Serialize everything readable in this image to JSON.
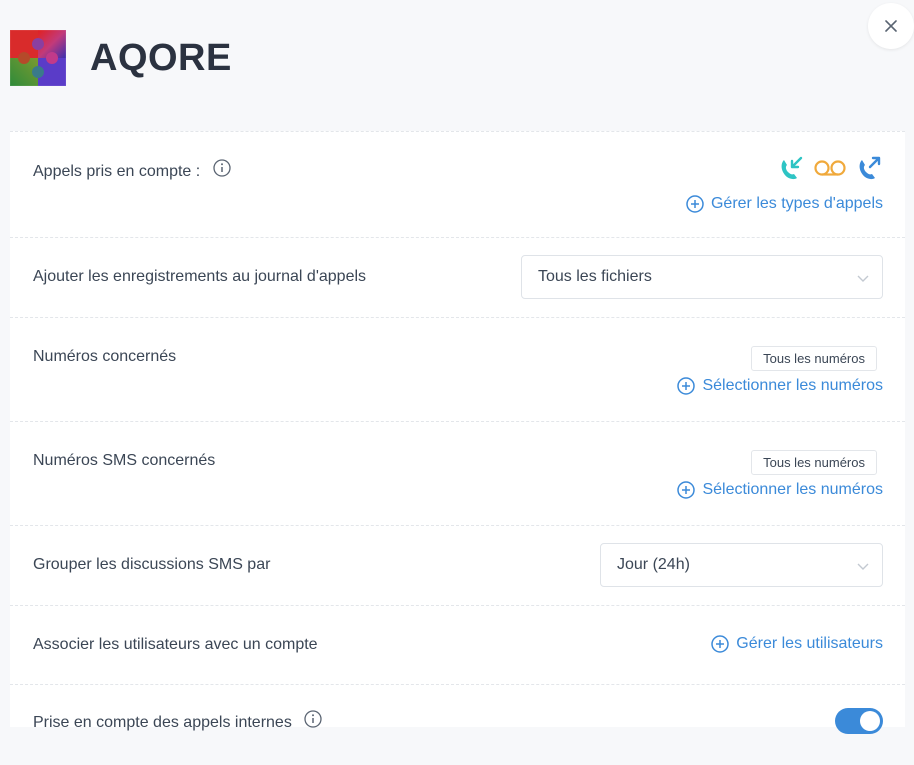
{
  "header": {
    "title": "AQORE",
    "close_icon": "close-icon"
  },
  "rows": {
    "calls": {
      "label": "Appels pris en compte :",
      "icons": [
        "incoming-call-icon",
        "voicemail-icon",
        "outgoing-call-icon"
      ],
      "link": "Gérer les types d'appels"
    },
    "recordings": {
      "label": "Ajouter les enregistrements au journal d'appels",
      "value": "Tous les fichiers"
    },
    "numbers": {
      "label": "Numéros concernés",
      "tag": "Tous les numéros",
      "link": "Sélectionner les numéros"
    },
    "sms_numbers": {
      "label": "Numéros SMS concernés",
      "tag": "Tous les numéros",
      "link": "Sélectionner les numéros"
    },
    "group_sms": {
      "label": "Grouper les discussions SMS par",
      "value": "Jour (24h)"
    },
    "users": {
      "label": "Associer les utilisateurs avec un compte",
      "link": "Gérer les utilisateurs"
    },
    "internal": {
      "label": "Prise en compte des appels internes",
      "enabled": true
    }
  },
  "colors": {
    "accent": "#3b8ad9",
    "incoming": "#2ec4c4",
    "voicemail": "#f0a93b",
    "outgoing": "#3b8ad9"
  }
}
